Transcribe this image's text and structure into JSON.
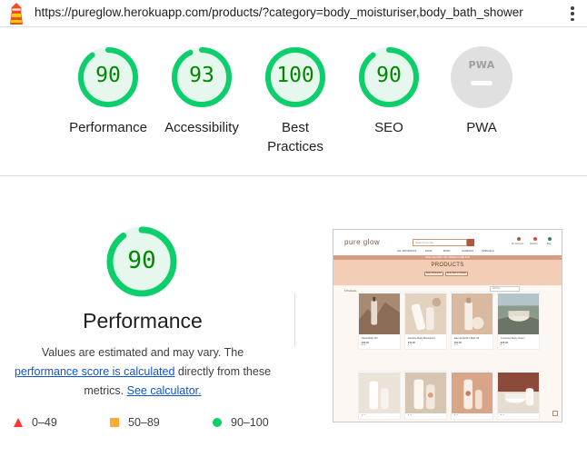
{
  "urlbar": {
    "url": "https://pureglow.herokuapp.com/products/?category=body_moisturiser,body_bath_shower",
    "lighthouse_icon": "lighthouse-icon",
    "menu_icon": "kebab-menu-icon"
  },
  "scores": [
    {
      "label": "Performance",
      "score": 90,
      "fraction": 0.9
    },
    {
      "label": "Accessibility",
      "score": 93,
      "fraction": 0.93
    },
    {
      "label": "Best Practices",
      "score": 100,
      "fraction": 1.0
    },
    {
      "label": "SEO",
      "score": 90,
      "fraction": 0.9
    }
  ],
  "pwa": {
    "badge_text": "PWA",
    "label": "PWA"
  },
  "colors": {
    "pass": "#0cce6b",
    "pass_bg": "#e6f8ee",
    "pass_text": "#008800",
    "average": "#ffaa33",
    "fail": "#ff3333",
    "link": "#1155cc"
  },
  "detail": {
    "score": 90,
    "fraction": 0.9,
    "title": "Performance",
    "desc_1": "Values are estimated and may vary. The",
    "link_1": "performance score is calculated",
    "desc_2": "directly from these",
    "desc_3": "metrics.",
    "link_2": "See calculator."
  },
  "legend": [
    {
      "range": "0–49",
      "shape": "triangle",
      "color": "#ff3333"
    },
    {
      "range": "50–89",
      "shape": "square",
      "color": "#ffaa33"
    },
    {
      "range": "90–100",
      "shape": "circle",
      "color": "#0cce6b"
    }
  ],
  "thumbnail": {
    "logo": "pure glow",
    "search_placeholder": "Search our site",
    "nav_icons": [
      "My Account",
      "Wishlist",
      "Bag"
    ],
    "menu": [
      "ALL PRODUCTS",
      "FACE",
      "BODY",
      "CANDLES",
      "SPECIALS"
    ],
    "banner": "FREE DELIVERY ON ORDERS OVER €50!",
    "heading": "PRODUCTS",
    "pills": [
      "Body Moisturiser",
      "Body Bath & Shower"
    ],
    "count": "6 Products",
    "sort": "Sort by...",
    "products": [
      {
        "name": "Neroli Body Oil",
        "price": "€33.00"
      },
      {
        "name": "Jasmine Body Moisturiser",
        "price": "€33.00"
      },
      {
        "name": "Eau de Parfum Bath Oil",
        "price": "€22.00"
      },
      {
        "name": "Luxurious Body Cream",
        "price": "€25.00"
      }
    ]
  }
}
